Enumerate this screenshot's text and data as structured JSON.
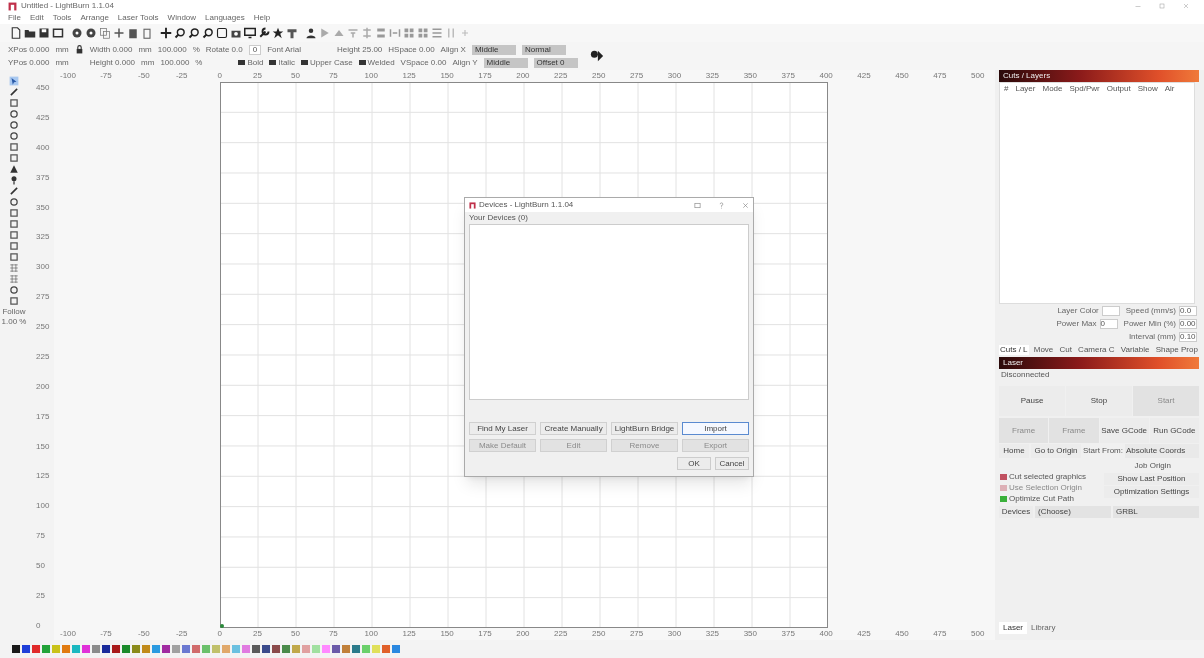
{
  "window": {
    "title": "Untitled - LightBurn 1.1.04"
  },
  "menu": [
    "File",
    "Edit",
    "Tools",
    "Arrange",
    "Laser Tools",
    "Window",
    "Languages",
    "Help"
  ],
  "shape_toolbar": [
    [
      {
        "kind": "label",
        "text": "XPos 0.000"
      },
      {
        "kind": "label",
        "text": "mm"
      },
      {
        "kind": "lock"
      },
      {
        "kind": "label",
        "text": "Width 0.000"
      },
      {
        "kind": "label",
        "text": "mm"
      },
      {
        "kind": "label",
        "text": "100.000"
      },
      {
        "kind": "label",
        "text": "%"
      },
      {
        "kind": "label",
        "text": "Rotate 0.0"
      },
      {
        "kind": "field",
        "text": "0"
      },
      {
        "kind": "label",
        "text": "Font Arial"
      },
      {
        "kind": "gap"
      },
      {
        "kind": "label",
        "text": "Height 25.00"
      },
      {
        "kind": "label",
        "text": "HSpace 0.00"
      },
      {
        "kind": "label",
        "text": "Align X"
      },
      {
        "kind": "dropdown",
        "text": "Middle"
      },
      {
        "kind": "dropdown",
        "text": "Normal"
      }
    ],
    [
      {
        "kind": "label",
        "text": "YPos 0.000"
      },
      {
        "kind": "label",
        "text": "mm"
      },
      {
        "kind": "spacer"
      },
      {
        "kind": "label",
        "text": "Height 0.000"
      },
      {
        "kind": "label",
        "text": "mm"
      },
      {
        "kind": "label",
        "text": "100.000"
      },
      {
        "kind": "label",
        "text": "%"
      },
      {
        "kind": "gap"
      },
      {
        "kind": "check",
        "text": "Bold",
        "checked": false
      },
      {
        "kind": "check",
        "text": "Italic",
        "checked": false
      },
      {
        "kind": "check",
        "text": "Upper Case",
        "checked": false
      },
      {
        "kind": "check",
        "text": "Welded",
        "checked": false
      },
      {
        "kind": "label",
        "text": "VSpace 0.00"
      },
      {
        "kind": "label",
        "text": "Align Y"
      },
      {
        "kind": "dropdown",
        "text": "Middle"
      },
      {
        "kind": "dropdown",
        "text": "Offset 0"
      }
    ]
  ],
  "left_tools_footer": [
    "Follow",
    "1.00 %"
  ],
  "top_ruler": [
    "-100",
    "-75",
    "-50",
    "-25",
    "0",
    "25",
    "50",
    "75",
    "100",
    "125",
    "150",
    "175",
    "200",
    "225",
    "250",
    "275",
    "300",
    "325",
    "350",
    "375",
    "400",
    "425",
    "450",
    "475",
    "500"
  ],
  "left_ruler": [
    "450",
    "425",
    "400",
    "375",
    "350",
    "325",
    "300",
    "275",
    "250",
    "225",
    "200",
    "175",
    "150",
    "125",
    "100",
    "75",
    "50",
    "25",
    "0"
  ],
  "bottom_ruler": [
    "-100",
    "-75",
    "-50",
    "-25",
    "0",
    "25",
    "50",
    "75",
    "100",
    "125",
    "150",
    "175",
    "200",
    "225",
    "250",
    "275",
    "300",
    "325",
    "350",
    "375",
    "400",
    "425",
    "450",
    "475",
    "500"
  ],
  "dialog": {
    "title": "Devices - LightBurn 1.1.04",
    "label": "Your Devices (0)",
    "buttons": [
      {
        "label": "Find My Laser",
        "disabled": false,
        "focused": false
      },
      {
        "label": "Create Manually",
        "disabled": false,
        "focused": false
      },
      {
        "label": "LightBurn Bridge",
        "disabled": false,
        "focused": false
      },
      {
        "label": "Import",
        "disabled": false,
        "focused": true
      },
      {
        "label": "Make Default",
        "disabled": true,
        "focused": false
      },
      {
        "label": "Edit",
        "disabled": true,
        "focused": false
      },
      {
        "label": "Remove",
        "disabled": true,
        "focused": false
      },
      {
        "label": "Export",
        "disabled": true,
        "focused": false
      }
    ],
    "actions": [
      "OK",
      "Cancel"
    ]
  },
  "cuts_layers": {
    "title": "Cuts / Layers",
    "columns": [
      "#",
      "Layer",
      "Mode",
      "Spd/Pwr",
      "Output",
      "Show",
      "Air"
    ],
    "settings": [
      {
        "label": "Layer Color"
      },
      {
        "label": "Speed (mm/s)",
        "value": "0.0"
      },
      {
        "label": "Power Max",
        "value": "0"
      },
      {
        "label": "Power Min (%)",
        "value": "0.00"
      },
      {
        "label": "Interval (mm)",
        "value": "0.10"
      }
    ]
  },
  "panel_tabs": [
    {
      "label": "Cuts / L",
      "selected": true
    },
    {
      "label": "Move",
      "selected": false
    },
    {
      "label": "Cut",
      "selected": false
    },
    {
      "label": "Camera C",
      "selected": false
    },
    {
      "label": "Variable",
      "selected": false
    },
    {
      "label": "Shape Prop",
      "selected": false
    }
  ],
  "laser": {
    "title": "Laser",
    "status": "Disconnected",
    "main_buttons": [
      {
        "label": "Pause",
        "disabled": false
      },
      {
        "label": "Stop",
        "disabled": false
      },
      {
        "label": "Start",
        "disabled": true
      }
    ],
    "frame_buttons": [
      {
        "label": "Frame",
        "disabled": true
      },
      {
        "label": "Frame",
        "disabled": true
      },
      {
        "label": "Save GCode",
        "disabled": false
      },
      {
        "label": "Run GCode",
        "disabled": false
      }
    ],
    "home": "Home",
    "go_origin": "Go to Origin",
    "start_from_label": "Start From:",
    "start_from": "Absolute Coords",
    "job_origin_label": "Job Origin",
    "options": [
      {
        "label": "Cut selected graphics",
        "checked": false,
        "disabled": false
      },
      {
        "label": "Use Selection Origin",
        "checked": false,
        "disabled": true
      },
      {
        "label": "Optimize Cut Path",
        "checked": true,
        "disabled": false
      }
    ],
    "side_buttons": [
      "Show Last Position",
      "Optimization Settings"
    ],
    "devices": "Devices",
    "device": "(Choose)",
    "controller": "GRBL"
  },
  "bottom_tabs": [
    {
      "label": "Laser",
      "selected": true
    },
    {
      "label": "Library",
      "selected": false
    }
  ],
  "palette": [
    {
      "color": "#1a1a1a"
    },
    {
      "color": "#1f3fd8"
    },
    {
      "color": "#e02a2a"
    },
    {
      "color": "#22a33a"
    },
    {
      "color": "#c9c21a"
    },
    {
      "color": "#e07a10"
    },
    {
      "color": "#1ab8c0"
    },
    {
      "color": "#e030d8"
    },
    {
      "color": "#8a8a8a"
    },
    {
      "color": "#1a2a9a"
    },
    {
      "color": "#a81a1a"
    },
    {
      "color": "#1a8a2a"
    },
    {
      "color": "#8a8a1a"
    },
    {
      "color": "#c08a1a"
    },
    {
      "color": "#2a9ae0"
    },
    {
      "color": "#a02aa0"
    },
    {
      "color": "#a0a0a0"
    },
    {
      "color": "#6a78d0"
    },
    {
      "color": "#d06a6a"
    },
    {
      "color": "#6ac06a"
    },
    {
      "color": "#c0c06a"
    },
    {
      "color": "#e0a86a"
    },
    {
      "color": "#6ac0e0"
    },
    {
      "color": "#e07ae0"
    },
    {
      "color": "#5a5a5a"
    },
    {
      "color": "#3a4a8a"
    },
    {
      "color": "#8a4a4a"
    },
    {
      "color": "#4a8a4a"
    },
    {
      "color": "#c0a84a"
    },
    {
      "color": "#e0a0a0"
    },
    {
      "color": "#a0e0a0"
    },
    {
      "color": "#ff88ff"
    },
    {
      "color": "#6a5aa8"
    },
    {
      "color": "#c0803a"
    },
    {
      "color": "#2a7a8a"
    },
    {
      "color": "#6ad06a"
    },
    {
      "color": "#e0e05a"
    },
    {
      "color": "#e0602a"
    },
    {
      "color": "#2a88e0"
    }
  ]
}
